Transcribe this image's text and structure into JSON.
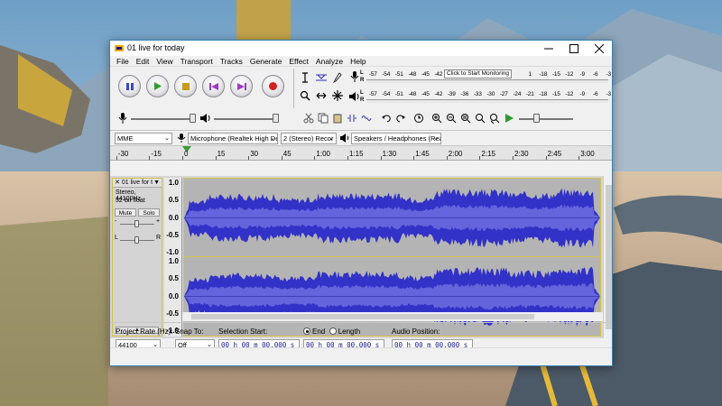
{
  "window": {
    "title": "01 live for today"
  },
  "menu": [
    "File",
    "Edit",
    "View",
    "Transport",
    "Tracks",
    "Generate",
    "Effect",
    "Analyze",
    "Help"
  ],
  "transport_buttons": [
    {
      "name": "pause-button",
      "icon": "pause-icon"
    },
    {
      "name": "play-button",
      "icon": "play-icon"
    },
    {
      "name": "stop-button",
      "icon": "stop-icon"
    },
    {
      "name": "skip-start-button",
      "icon": "skip-start-icon"
    },
    {
      "name": "skip-end-button",
      "icon": "skip-end-icon"
    },
    {
      "name": "record-button",
      "icon": "record-icon"
    }
  ],
  "meters": {
    "record_scale": [
      "-57",
      "-54",
      "-51",
      "-48",
      "-45",
      "-42",
      "-3",
      "",
      "",
      "",
      "",
      "",
      "1",
      "-18",
      "-15",
      "-12",
      "-9",
      "-6",
      "-3",
      "0"
    ],
    "monitor_label": "Click to Start Monitoring",
    "play_scale": [
      "-57",
      "-54",
      "-51",
      "-48",
      "-45",
      "-42",
      "-39",
      "-36",
      "-33",
      "-30",
      "-27",
      "-24",
      "-21",
      "-18",
      "-15",
      "-12",
      "-9",
      "-6",
      "-3",
      "0"
    ],
    "l": "L",
    "r": "R"
  },
  "device": {
    "host": "MME",
    "input": "Microphone (Realtek High Defi",
    "channels": "2 (Stereo) Recor",
    "output": "Speakers / Headphones (Realtek"
  },
  "timeline": {
    "ticks": [
      "-30",
      "-15",
      "0",
      "15",
      "30",
      "45",
      "1:00",
      "1:15",
      "1:30",
      "1:45",
      "2:00",
      "2:15",
      "2:30",
      "2:45",
      "3:00"
    ]
  },
  "track": {
    "name": "01 live for t",
    "close": "✕",
    "menu_arrow": "▼",
    "info_rate": "Stereo, 44100Hz",
    "info_fmt": "32-bit float",
    "mute": "Mute",
    "solo": "Solo",
    "gain_minus": "-",
    "gain_plus": "+",
    "pan_l": "L",
    "pan_r": "R",
    "collapse": "▲",
    "vruler": [
      "1.0",
      "0.5",
      "0.0",
      "-0.5",
      "-1.0"
    ]
  },
  "selection": {
    "project_rate_label": "Project Rate (Hz):",
    "project_rate": "44100",
    "snap_label": "Snap To:",
    "snap_value": "Off",
    "sel_start_label": "Selection Start:",
    "end_label": "End",
    "length_label": "Length",
    "audio_pos_label": "Audio Position:",
    "time_start": "00 h 00 m 00.000 s",
    "time_end": "00 h 00 m 00.000 s",
    "time_pos": "00 h 00 m 00.000 s"
  },
  "colors": {
    "wave": "#3232c8",
    "wave_rms": "#6464dc",
    "accent": "#3c7fb1"
  }
}
